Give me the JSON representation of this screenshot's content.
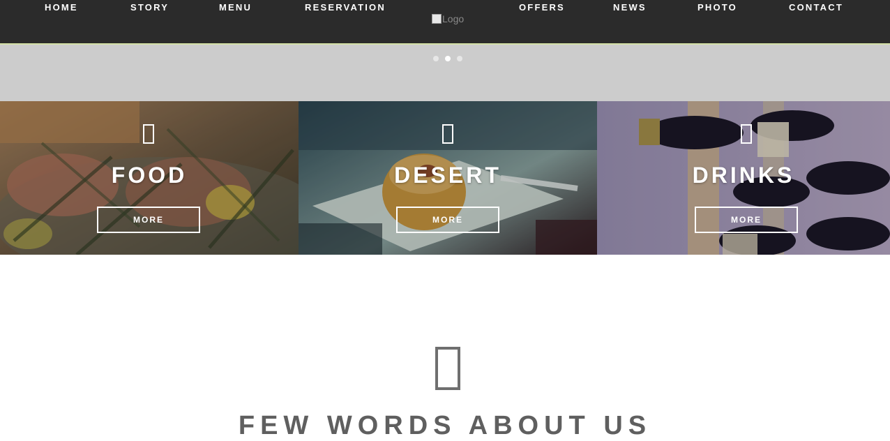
{
  "nav": {
    "left": [
      "HOME",
      "STORY",
      "MENU",
      "RESERVATION"
    ],
    "right": [
      "OFFERS",
      "NEWS",
      "PHOTO",
      "CONTACT"
    ],
    "logo_alt": "Logo"
  },
  "slider": {
    "dots": 3,
    "active_index": 1
  },
  "tiles": [
    {
      "title": "FOOD",
      "button": "MORE",
      "icon": "box-icon"
    },
    {
      "title": "DESERT",
      "button": "MORE",
      "icon": "box-icon"
    },
    {
      "title": "DRINKS",
      "button": "MORE",
      "icon": "box-icon"
    }
  ],
  "about": {
    "title": "FEW WORDS ABOUT US",
    "icon": "box-icon"
  },
  "colors": {
    "nav_bg": "#2b2b2b",
    "nav_border": "#d4e0a6",
    "slider_bg": "#cccccc",
    "heading": "#5f5f5f"
  }
}
